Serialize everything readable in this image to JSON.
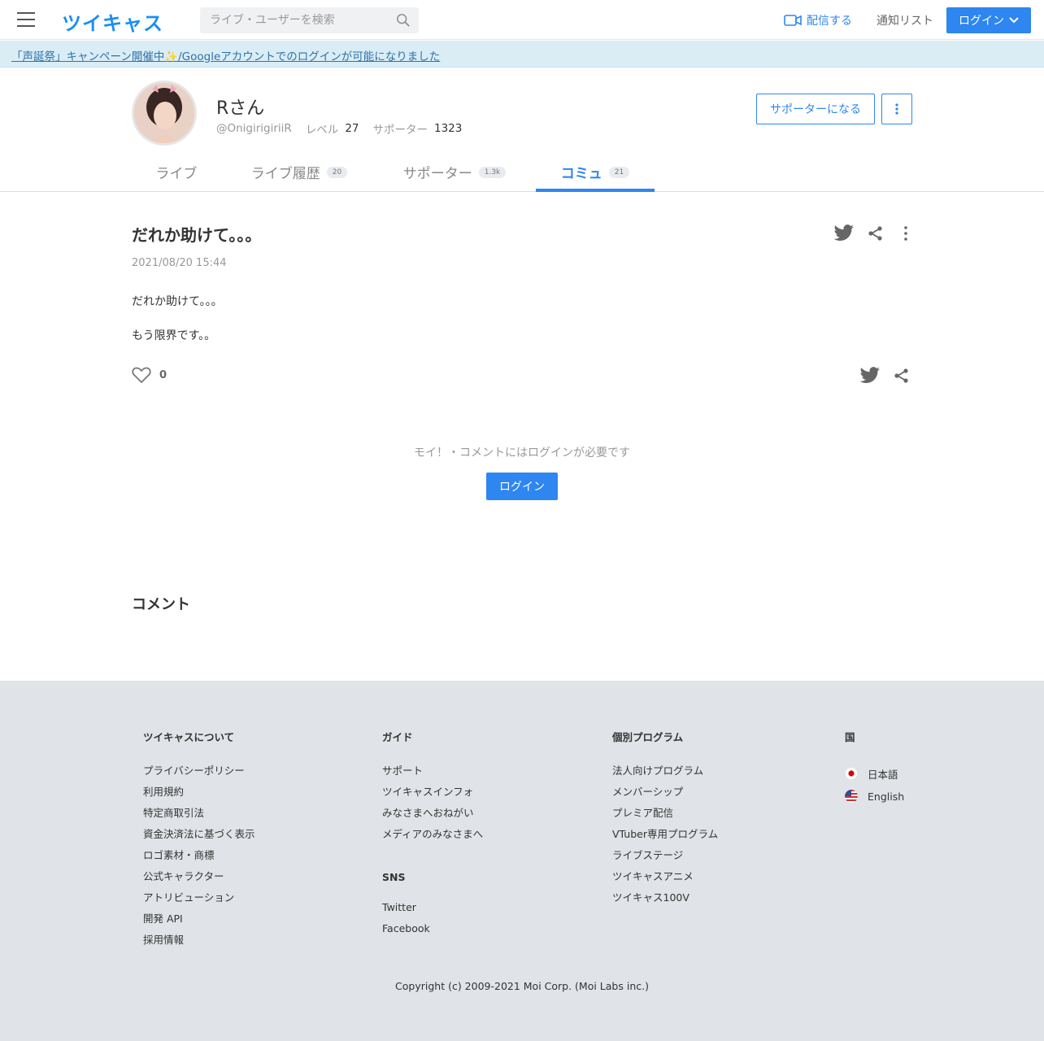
{
  "header": {
    "logo": "ツイキャス",
    "search_placeholder": "ライブ・ユーザーを検索",
    "broadcast": "配信する",
    "notify": "通知リスト",
    "login": "ログイン"
  },
  "banner": {
    "text": "「声誕祭」キャンペーン開催中✨/Googleアカウントでのログインが可能になりました"
  },
  "profile": {
    "name": "Rさん",
    "handle": "@OnigirigiriiR",
    "level_label": "レベル",
    "level_value": "27",
    "supporter_label": "サポーター",
    "supporter_value": "1323",
    "support_button": "サポーターになる"
  },
  "tabs": [
    {
      "label": "ライブ",
      "count": ""
    },
    {
      "label": "ライブ履歴",
      "count": "20"
    },
    {
      "label": "サポーター",
      "count": "1.3k"
    },
    {
      "label": "コミュ",
      "count": "21"
    }
  ],
  "post": {
    "title": "だれか助けて。。。",
    "date": "2021/08/20 15:44",
    "line1": "だれか助けて。。。",
    "line2": "もう限界です。。",
    "likes": "0"
  },
  "login_note": "モイ！・コメントにはログインが必要です",
  "login_button": "ログイン",
  "comments_heading": "コメント",
  "footer": {
    "about": {
      "heading": "ツイキャスについて",
      "links": [
        "プライバシーポリシー",
        "利用規約",
        "特定商取引法",
        "資金決済法に基づく表示",
        "ロゴ素材・商標",
        "公式キャラクター",
        "アトリビューション",
        "開発 API",
        "採用情報"
      ]
    },
    "guide": {
      "heading": "ガイド",
      "links": [
        "サポート",
        "ツイキャスインフォ",
        "みなさまへおねがい",
        "メディアのみなさまへ"
      ]
    },
    "sns": {
      "heading": "SNS",
      "links": [
        "Twitter",
        "Facebook"
      ]
    },
    "programs": {
      "heading": "個別プログラム",
      "links": [
        "法人向けプログラム",
        "メンバーシップ",
        "プレミア配信",
        "VTuber専用プログラム",
        "ライブステージ",
        "ツイキャスアニメ",
        "ツイキャス100V"
      ]
    },
    "country": {
      "heading": "国",
      "langs": [
        "日本語",
        "English"
      ]
    },
    "copyright": "Copyright (c) 2009-2021 Moi Corp. (Moi Labs inc.)"
  },
  "colors": {
    "accent": "#2e86f0",
    "banner_bg": "#daedf5",
    "footer_bg": "#e0e3e7"
  }
}
